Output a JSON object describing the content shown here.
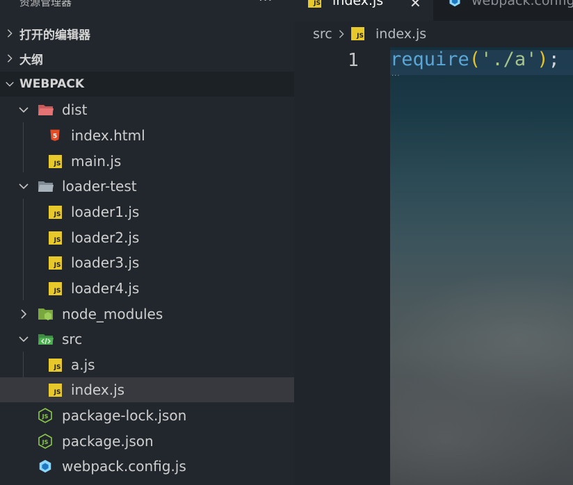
{
  "sidebar": {
    "title": "资源管理器",
    "more": "···",
    "sections": {
      "open_editors": "打开的编辑器",
      "outline": "大纲",
      "project": "WEBPACK"
    },
    "tree": {
      "dist": "dist",
      "dist_index_html": "index.html",
      "dist_main_js": "main.js",
      "loader_test": "loader-test",
      "loader1": "loader1.js",
      "loader2": "loader2.js",
      "loader3": "loader3.js",
      "loader4": "loader4.js",
      "node_modules": "node_modules",
      "src": "src",
      "src_a_js": "a.js",
      "src_index_js": "index.js",
      "package_lock": "package-lock.json",
      "package_json": "package.json",
      "webpack_config": "webpack.config.js"
    },
    "icons": {
      "js_badge_text": "JS",
      "html_badge_text": "5",
      "json_badge_text": "JS"
    }
  },
  "editor": {
    "tabs": {
      "active": "index.js",
      "inactive": "webpack.config",
      "close": "✕"
    },
    "breadcrumb": {
      "folder": "src",
      "file": "index.js"
    },
    "code": {
      "line_number": "1",
      "fn": "require",
      "open_paren": "(",
      "string": "'./a'",
      "close_paren": ")",
      "semicolon": ";",
      "hint": "···"
    }
  },
  "colors": {
    "js": "#e8c92b",
    "html": "#e44d26",
    "node": "#8cc84b",
    "webpack": "#8ed6fb",
    "src_folder": "#4caf50",
    "dist_folder": "#e57373"
  }
}
